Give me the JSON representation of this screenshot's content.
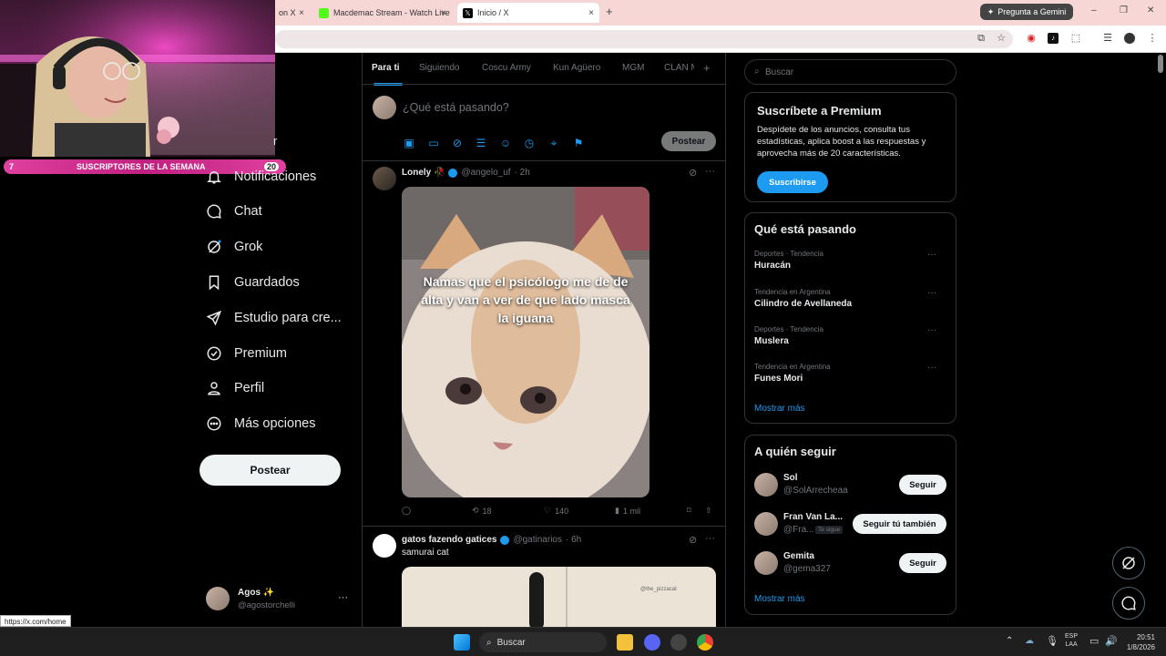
{
  "browser": {
    "tabs": [
      {
        "label": "on X",
        "close": "×"
      },
      {
        "label": "Macdemac Stream - Watch Live",
        "close": "×"
      },
      {
        "label": "Inicio / X",
        "close": "×"
      }
    ],
    "new_tab": "+",
    "gemini_button": "Pregunta a Gemini",
    "window": {
      "minimize": "–",
      "restore": "❐",
      "close": "✕"
    },
    "status_url": "https://x.com/home"
  },
  "stream_overlay": {
    "subs_label": "SUSCRIPTORES DE LA SEMANA",
    "left_count": "7",
    "right_count": "20"
  },
  "sidebar": {
    "partial_text": "r",
    "items": [
      {
        "label": "Notificaciones",
        "icon": "bell-icon"
      },
      {
        "label": "Chat",
        "icon": "chat-icon"
      },
      {
        "label": "Grok",
        "icon": "grok-icon"
      },
      {
        "label": "Guardados",
        "icon": "bookmark-icon"
      },
      {
        "label": "Estudio para cre...",
        "icon": "rocket-icon"
      },
      {
        "label": "Premium",
        "icon": "verified-icon"
      },
      {
        "label": "Perfil",
        "icon": "person-icon"
      },
      {
        "label": "Más opciones",
        "icon": "more-circle-icon"
      }
    ],
    "post_button": "Postear",
    "account": {
      "name": "Agos ✨",
      "handle": "@agostorchelli",
      "more": "···"
    }
  },
  "feed": {
    "tabs": [
      "Para ti",
      "Siguiendo",
      "Coscu Army",
      "Kun Agüero",
      "MGM",
      "CLAN M"
    ],
    "add_tab": "+",
    "composer": {
      "placeholder": "¿Qué está pasando?",
      "post_button": "Postear"
    },
    "tweets": [
      {
        "name": "Lonely 🥀",
        "handle": "@angelo_uf",
        "time": "· 2h",
        "image_caption": "Namas que el psicólogo me de de alta y van a ver de que lado masca la iguana",
        "retweets": "18",
        "likes": "140",
        "views": "1 mil"
      },
      {
        "name": "gatos fazendo gatices",
        "handle": "@gatinarios",
        "time": "· 6h",
        "text": "samurai cat",
        "watermark": "@the_pizzacat"
      }
    ]
  },
  "right": {
    "search_placeholder": "Buscar",
    "premium": {
      "title": "Suscríbete a Premium",
      "text": "Despídete de los anuncios, consulta tus estadísticas, aplica boost a las respuestas y aprovecha más de 20 características.",
      "button": "Suscribirse"
    },
    "trends": {
      "title": "Qué está pasando",
      "items": [
        {
          "category": "Deportes · Tendencia",
          "name": "Huracán"
        },
        {
          "category": "Tendencia en Argentina",
          "name": "Cilindro de Avellaneda"
        },
        {
          "category": "Deportes · Tendencia",
          "name": "Muslera"
        },
        {
          "category": "Tendencia en Argentina",
          "name": "Funes Mori"
        }
      ],
      "show_more": "Mostrar más"
    },
    "who_to_follow": {
      "title": "A quién seguir",
      "items": [
        {
          "name": "Sol",
          "handle": "@SolArrecheaa",
          "button": "Seguir",
          "badge": ""
        },
        {
          "name": "Fran Van La...",
          "handle": "@Fra...",
          "button": "Seguir tú también",
          "badge": "Te sigue"
        },
        {
          "name": "Gemita",
          "handle": "@gema327",
          "button": "Seguir",
          "badge": ""
        }
      ],
      "show_more": "Mostrar más"
    }
  },
  "taskbar": {
    "search": "Buscar",
    "lang": "ESP",
    "lang2": "LAA",
    "time": "20:51",
    "date": "1/8/2026"
  },
  "colors": {
    "accent": "#1d9bf0",
    "bg": "#000000",
    "border": "#2f3336",
    "muted": "#71767b"
  }
}
